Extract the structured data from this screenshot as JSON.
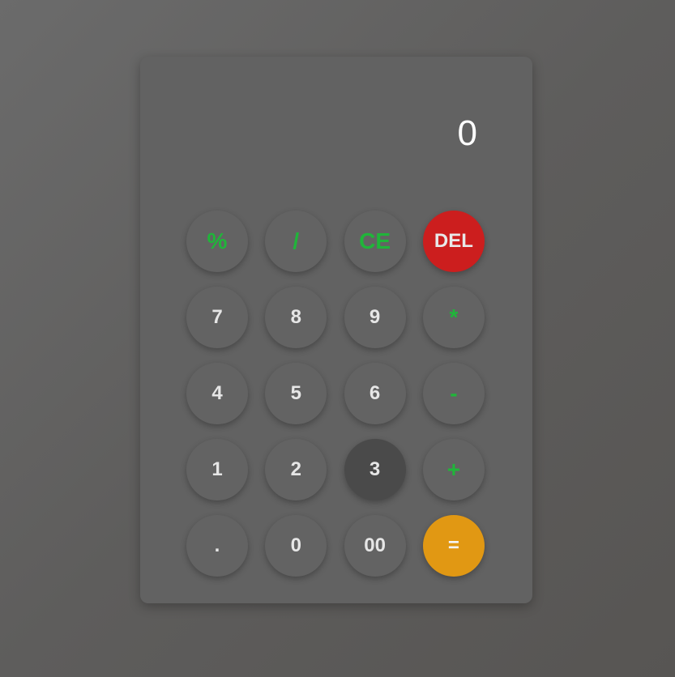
{
  "display": {
    "value": "0"
  },
  "keys": [
    {
      "label": "%",
      "name": "percent-button",
      "type": "op"
    },
    {
      "label": "/",
      "name": "divide-button",
      "type": "op"
    },
    {
      "label": "CE",
      "name": "clear-entry-button",
      "type": "op"
    },
    {
      "label": "DEL",
      "name": "delete-button",
      "type": "del"
    },
    {
      "label": "7",
      "name": "digit-7-button",
      "type": "num"
    },
    {
      "label": "8",
      "name": "digit-8-button",
      "type": "num"
    },
    {
      "label": "9",
      "name": "digit-9-button",
      "type": "num"
    },
    {
      "label": "*",
      "name": "multiply-button",
      "type": "op"
    },
    {
      "label": "4",
      "name": "digit-4-button",
      "type": "num"
    },
    {
      "label": "5",
      "name": "digit-5-button",
      "type": "num"
    },
    {
      "label": "6",
      "name": "digit-6-button",
      "type": "num"
    },
    {
      "label": "-",
      "name": "subtract-button",
      "type": "op"
    },
    {
      "label": "1",
      "name": "digit-1-button",
      "type": "num"
    },
    {
      "label": "2",
      "name": "digit-2-button",
      "type": "num"
    },
    {
      "label": "3",
      "name": "digit-3-button",
      "type": "num",
      "active": true
    },
    {
      "label": "+",
      "name": "add-button",
      "type": "op"
    },
    {
      "label": ".",
      "name": "decimal-point-button",
      "type": "num"
    },
    {
      "label": "0",
      "name": "digit-0-button",
      "type": "num"
    },
    {
      "label": "00",
      "name": "double-zero-button",
      "type": "num"
    },
    {
      "label": "=",
      "name": "equals-button",
      "type": "equals"
    }
  ],
  "colors": {
    "operator": "#20b53a",
    "delete": "#cc1e1e",
    "equals": "#e19813",
    "pressed": "#4a4a4a"
  }
}
